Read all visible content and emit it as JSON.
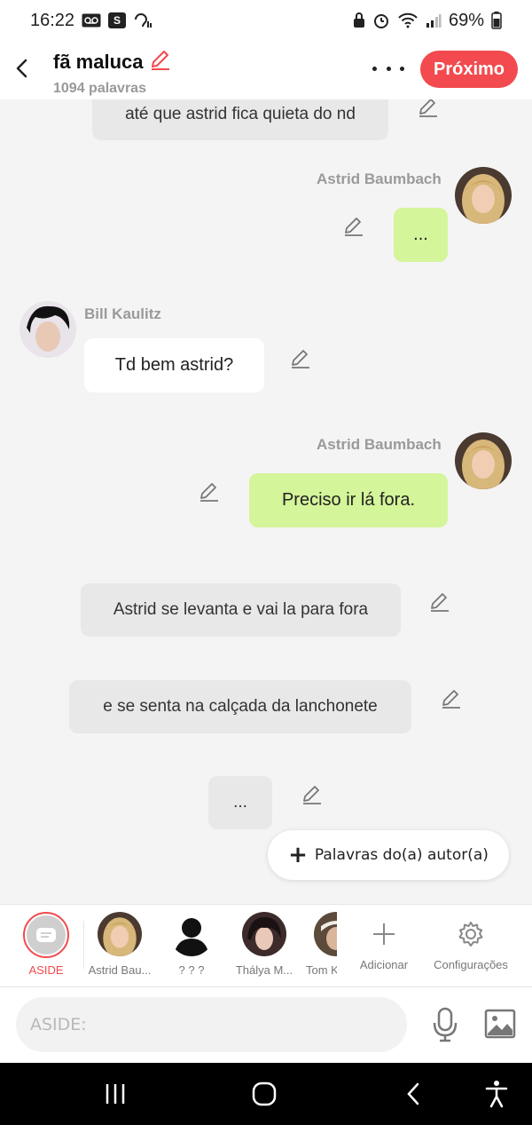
{
  "status_bar": {
    "time": "16:22",
    "battery": "69%"
  },
  "header": {
    "title": "fã maluca",
    "word_count": "1094 palavras",
    "next_label": "Próximo"
  },
  "chat": {
    "messages": [
      {
        "type": "narration",
        "text": "até que astrid fica quieta do nd"
      },
      {
        "type": "character",
        "speaker": "Astrid Baumbach",
        "side": "right",
        "text": "..."
      },
      {
        "type": "character",
        "speaker": "Bill Kaulitz",
        "side": "left",
        "text": "Td bem astrid?"
      },
      {
        "type": "character",
        "speaker": "Astrid Baumbach",
        "side": "right",
        "text": "Preciso ir lá fora."
      },
      {
        "type": "narration",
        "text": "Astrid se levanta e vai la para fora"
      },
      {
        "type": "narration",
        "text": "e se senta na calçada da lanchonete"
      },
      {
        "type": "narration",
        "text": "..."
      }
    ],
    "author_words_label": "Palavras do(a) autor(a)"
  },
  "characters": [
    {
      "label": "ASIDE"
    },
    {
      "label": "Astrid Bau..."
    },
    {
      "label": "? ? ?"
    },
    {
      "label": "Thálya M..."
    },
    {
      "label": "Tom K"
    },
    {
      "label": "Adicionar"
    },
    {
      "label": "Configurações"
    }
  ],
  "input": {
    "placeholder": "ASIDE:"
  },
  "colors": {
    "accent": "#f24a4e",
    "bubble_green": "#d4f59a",
    "bubble_gray": "#e8e8e8"
  }
}
